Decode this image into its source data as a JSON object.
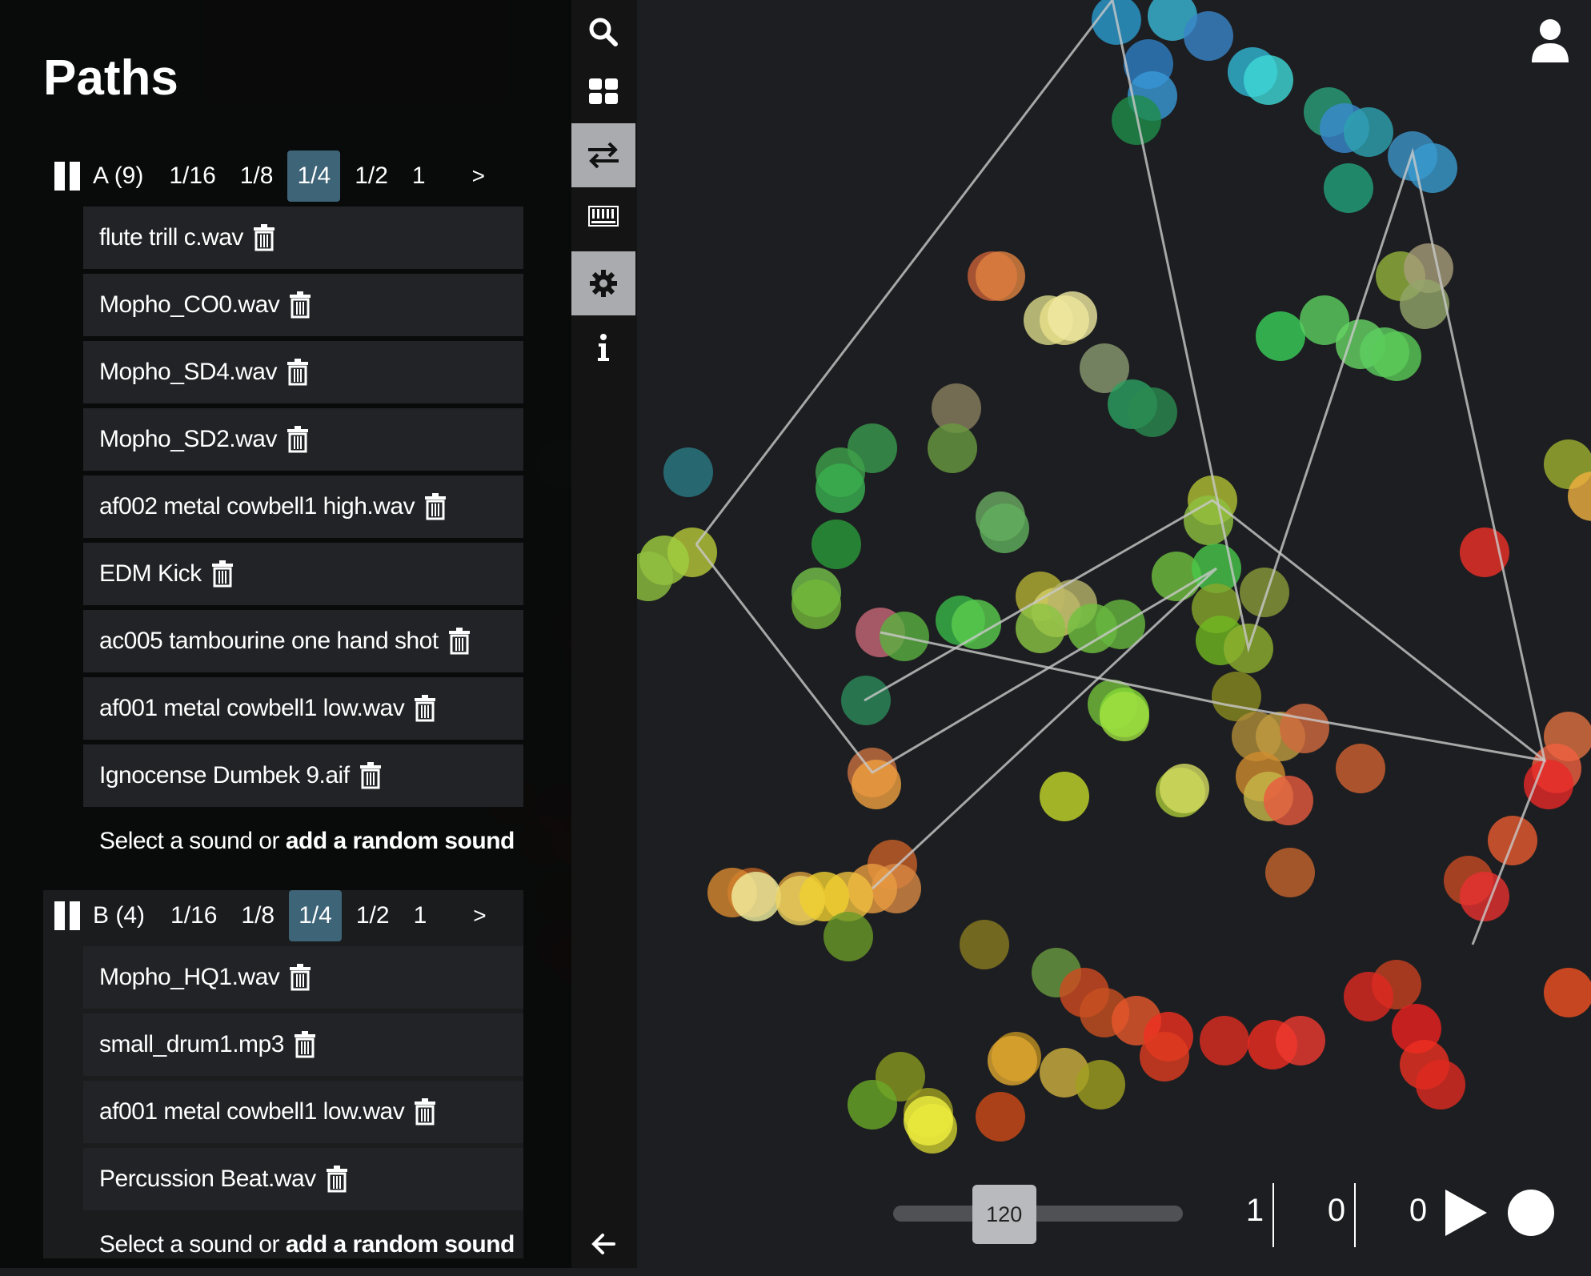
{
  "sidebar": {
    "title": "Paths",
    "rates": [
      "1/16",
      "1/8",
      "1/4",
      "1/2",
      "1"
    ],
    "next_label": ">",
    "paths": [
      {
        "name": "A (9)",
        "active_rate": "1/4",
        "sounds": [
          "flute trill c.wav",
          "Mopho_CO0.wav",
          "Mopho_SD4.wav",
          "Mopho_SD2.wav",
          "af002 metal cowbell1 high.wav",
          "EDM Kick",
          "ac005 tambourine one hand shot",
          "af001 metal cowbell1 low.wav",
          "Ignocense Dumbek 9.aif"
        ],
        "select_prefix": "Select a sound or ",
        "select_link": "add a random sound"
      },
      {
        "name": "B (4)",
        "active_rate": "1/4",
        "sounds": [
          "Mopho_HQ1.wav",
          "small_drum1.mp3",
          "af001 metal cowbell1 low.wav",
          "Percussion Beat.wav"
        ],
        "select_prefix": "Select a sound or ",
        "select_link": "add a random sound"
      }
    ]
  },
  "toolbar": {
    "items": [
      {
        "icon": "search-icon",
        "active": false
      },
      {
        "icon": "grid-icon",
        "active": false
      },
      {
        "icon": "swap-arrows-icon",
        "active": true
      },
      {
        "icon": "keyboard-icon",
        "active": false
      },
      {
        "icon": "gear-icon",
        "active": true
      },
      {
        "icon": "info-icon",
        "active": false
      }
    ],
    "collapse_icon": "arrow-left-icon"
  },
  "header": {
    "user_icon": "user-icon"
  },
  "transport": {
    "tempo": "120",
    "tempo_level": 0.35,
    "counters": [
      "1",
      "0",
      "0"
    ],
    "play_icon": "play-icon",
    "record_icon": "record-icon"
  },
  "colors": {
    "active_rate": "#3e6478",
    "toolbar_active": "#a9abae",
    "background": "#1d1e21"
  }
}
